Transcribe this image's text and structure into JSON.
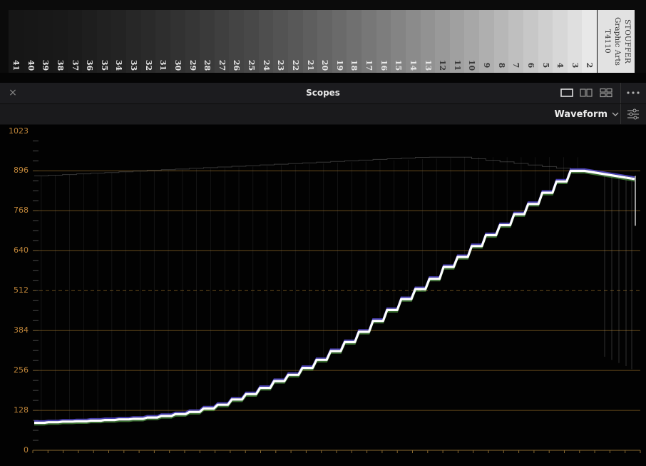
{
  "wedge": {
    "steps": [
      "41",
      "40",
      "39",
      "38",
      "37",
      "36",
      "35",
      "34",
      "33",
      "32",
      "31",
      "30",
      "29",
      "28",
      "27",
      "26",
      "25",
      "24",
      "23",
      "22",
      "21",
      "20",
      "19",
      "18",
      "17",
      "16",
      "15",
      "14",
      "13",
      "12",
      "11",
      "10",
      "9",
      "8",
      "7",
      "6",
      "5",
      "4",
      "3",
      "2"
    ],
    "label_lines": [
      "STOUFFER",
      "Graphic Arts",
      "T4110"
    ]
  },
  "titlebar": {
    "close_label": "×",
    "title": "Scopes",
    "layouts": [
      "single-view",
      "dual-view",
      "quad-view"
    ],
    "more_label": "more-options"
  },
  "toolbar": {
    "mode": "Waveform",
    "settings_label": "scope-settings"
  },
  "scope": {
    "y_axis_labels": [
      "1023",
      "896",
      "768",
      "640",
      "512",
      "384",
      "256",
      "128",
      "0"
    ],
    "y_axis_values": [
      1023,
      896,
      768,
      640,
      512,
      384,
      256,
      128,
      0
    ],
    "dashed_value": 512,
    "grid_color": "#7a5a22",
    "label_color": "#c0863a",
    "trace_color": "#ffffff",
    "step_levels": [
      88,
      90,
      92,
      93,
      95,
      97,
      99,
      101,
      105,
      110,
      116,
      123,
      134,
      146,
      163,
      180,
      200,
      222,
      242,
      264,
      290,
      318,
      347,
      380,
      415,
      450,
      485,
      517,
      550,
      588,
      620,
      655,
      690,
      722,
      757,
      790,
      826,
      862,
      896,
      874
    ]
  }
}
